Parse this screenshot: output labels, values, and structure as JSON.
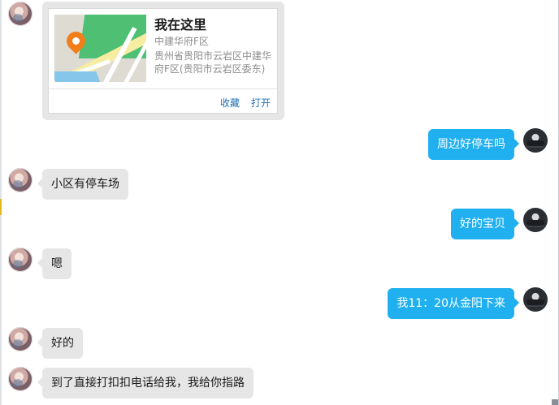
{
  "location_card": {
    "title": "我在这里",
    "name": "中建华府F区",
    "address": "贵州省贵阳市云岩区中建华府F区(贵阳市云岩区委东)",
    "actions": {
      "collect": "收藏",
      "open": "打开"
    }
  },
  "messages": [
    {
      "side": "right",
      "text": "周边好停车吗"
    },
    {
      "side": "left",
      "text": "小区有停车场"
    },
    {
      "side": "right",
      "text": "好的宝贝"
    },
    {
      "side": "left",
      "text": "嗯"
    },
    {
      "side": "right",
      "text": "我11：20从金阳下来"
    },
    {
      "side": "left",
      "text": "好的"
    },
    {
      "side": "left",
      "text": "到了直接打扣扣电话给我，我给你指路"
    }
  ],
  "colors": {
    "outgoing_bubble": "#20b0f0",
    "incoming_bubble": "#e6e6e6",
    "link": "#1f6fb5",
    "map_pin": "#f07e1b"
  }
}
